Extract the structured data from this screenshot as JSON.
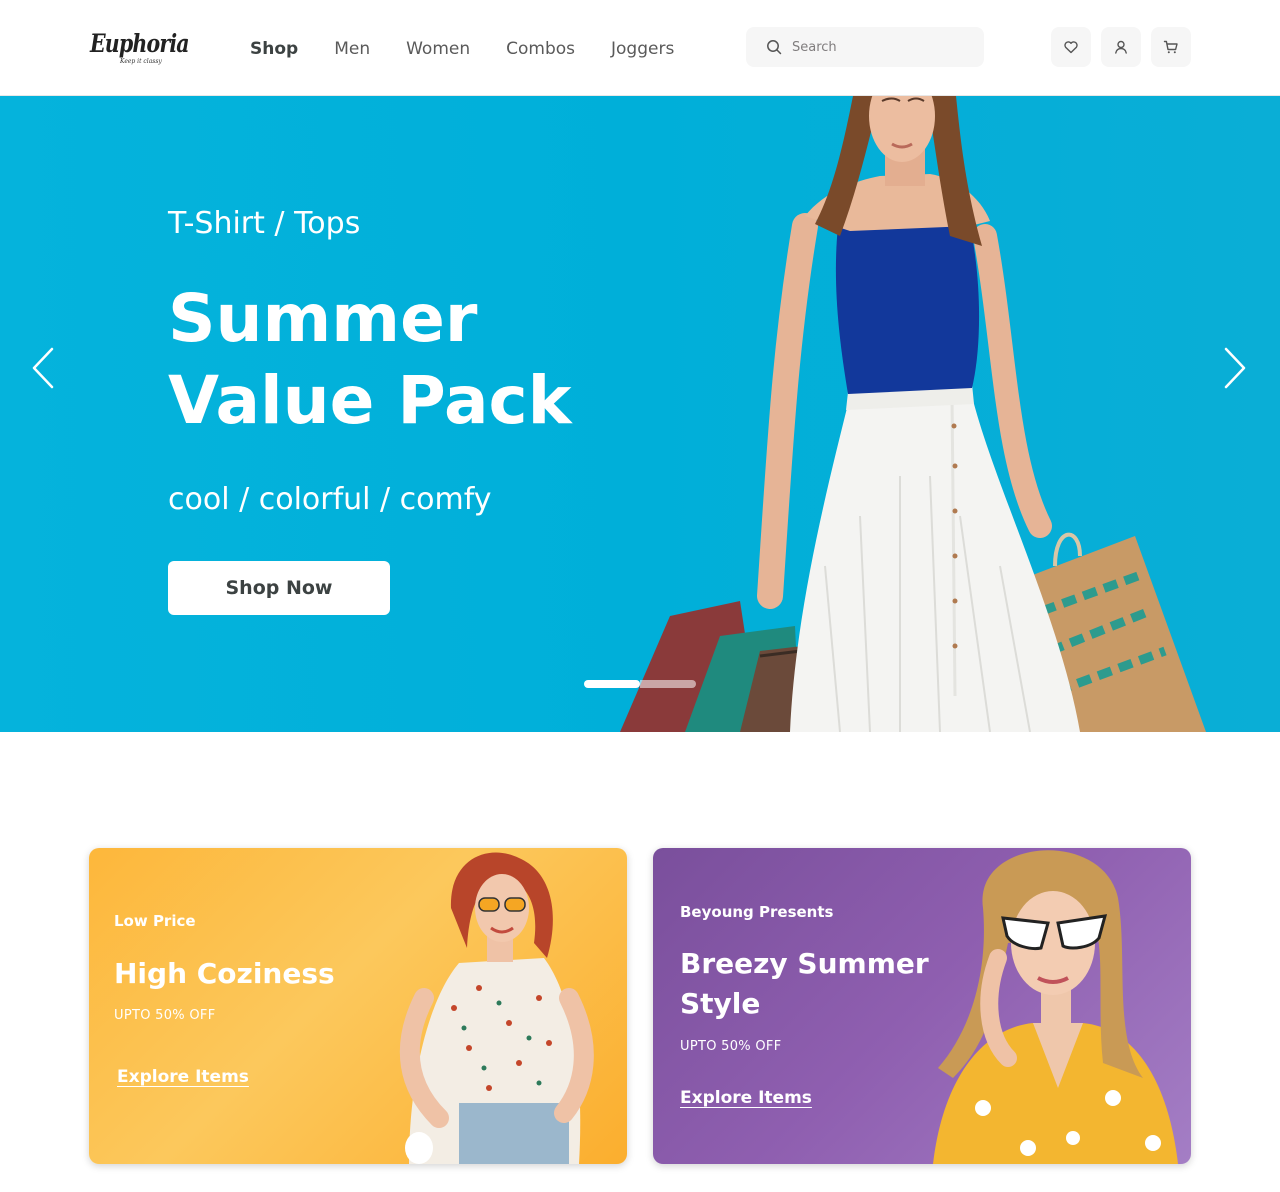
{
  "brand": {
    "name": "Euphoria",
    "tagline": "Keep it classy"
  },
  "nav": {
    "items": [
      "Shop",
      "Men",
      "Women",
      "Combos",
      "Joggers"
    ],
    "active": "Shop"
  },
  "search": {
    "placeholder": "Search"
  },
  "header_icons": [
    "heart-icon",
    "user-icon",
    "cart-icon"
  ],
  "hero": {
    "eyebrow": "T-Shirt / Tops",
    "title_line1": "Summer",
    "title_line2": "Value Pack",
    "subtitle": "cool / colorful / comfy",
    "cta": "Shop Now",
    "slide_current": 1,
    "slide_total": 2,
    "background": "#00afd9"
  },
  "promos": [
    {
      "eyebrow": "Low Price",
      "title": "High Coziness",
      "offer": "UPTO 50% OFF",
      "link": "Explore Items",
      "color": "#fdb73b"
    },
    {
      "eyebrow": "Beyoung Presents",
      "title_line1": "Breezy Summer",
      "title_line2": "Style",
      "offer": "UPTO 50% OFF",
      "link": "Explore Items",
      "color": "#8f5fb0"
    }
  ]
}
